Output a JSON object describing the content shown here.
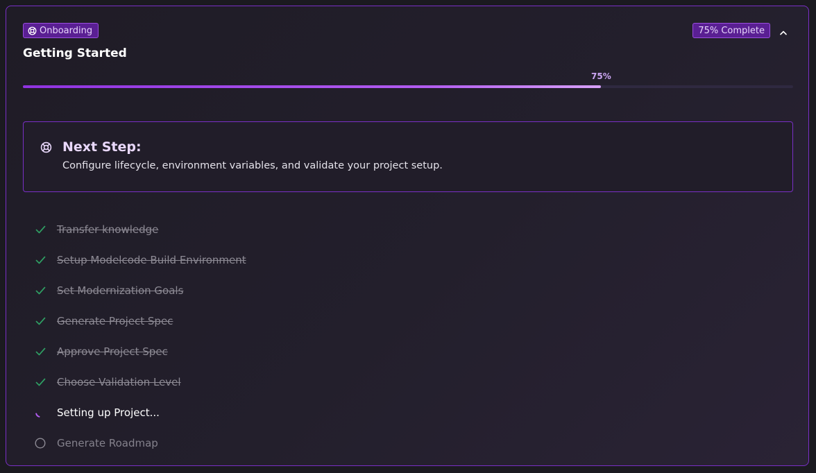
{
  "header": {
    "badge_label": "Onboarding",
    "title": "Getting Started",
    "complete_label": "75% Complete"
  },
  "progress": {
    "label": "75%",
    "value": 0.75
  },
  "next_step": {
    "title": "Next Step:",
    "description": "Configure lifecycle, environment variables, and validate your project setup."
  },
  "steps": [
    {
      "label": "Transfer knowledge",
      "status": "done"
    },
    {
      "label": "Setup Modelcode Build Environment",
      "status": "done"
    },
    {
      "label": "Set Modernization Goals",
      "status": "done"
    },
    {
      "label": "Generate Project Spec",
      "status": "done"
    },
    {
      "label": "Approve Project Spec",
      "status": "done"
    },
    {
      "label": "Choose Validation Level",
      "status": "done"
    },
    {
      "label": "Setting up Project...",
      "status": "in-progress"
    },
    {
      "label": "Generate Roadmap",
      "status": "pending"
    }
  ],
  "icons": {
    "badge": "lifebuoy-icon",
    "collapse": "chevron-up-icon",
    "next_step": "lifebuoy-icon",
    "done": "check-icon",
    "in_progress": "spinner-icon",
    "pending": "empty-circle-icon"
  },
  "colors": {
    "accent": "#7a2fc7",
    "progress_fill": "#b25cf0",
    "check": "#2f9e63",
    "background": "#1f1c26"
  }
}
